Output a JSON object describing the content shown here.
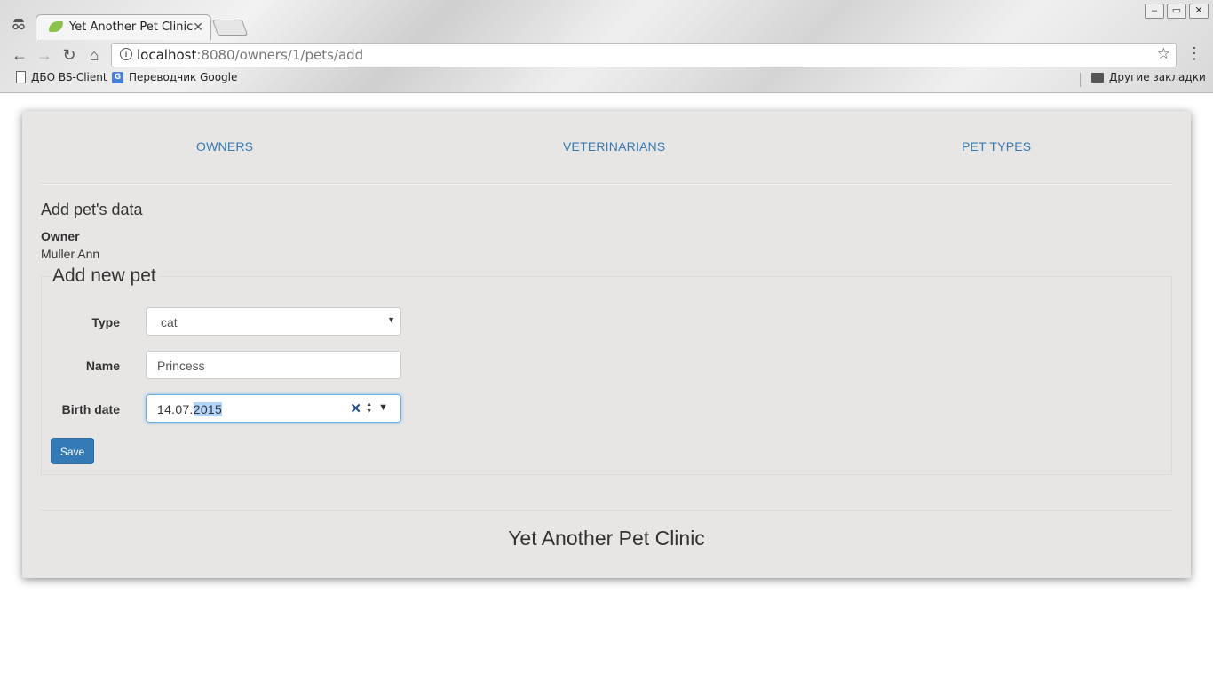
{
  "browser": {
    "tab_title": "Yet Another Pet Clinic",
    "url_host": "localhost",
    "url_path": ":8080/owners/1/pets/add",
    "bookmarks": [
      {
        "label": "ДБО BS-Client",
        "icon": "document-icon"
      },
      {
        "label": "Переводчик Google",
        "icon": "google-translate-icon"
      }
    ],
    "other_bookmarks": "Другие закладки"
  },
  "nav": {
    "owners": "OWNERS",
    "veterinarians": "VETERINARIANS",
    "pet_types": "PET TYPES"
  },
  "page": {
    "heading": "Add pet's data",
    "owner_label": "Owner",
    "owner_name": "Muller Ann"
  },
  "form": {
    "legend": "Add new pet",
    "type_label": "Type",
    "type_value": "cat",
    "name_label": "Name",
    "name_value": "Princess",
    "birth_label": "Birth date",
    "birth_prefix": "14.07.",
    "birth_selected": "2015",
    "save_label": "Save"
  },
  "footer": {
    "title": "Yet Another Pet Clinic"
  },
  "colors": {
    "link": "#337ab7",
    "card_bg": "#e8e6e4",
    "button": "#337ab7"
  }
}
